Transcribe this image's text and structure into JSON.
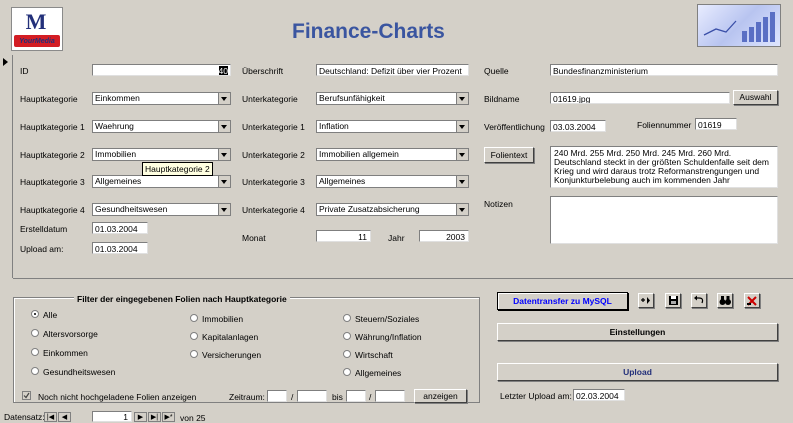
{
  "header": {
    "title": "Finance-Charts",
    "logo_text": "YourMedia",
    "logo_mark": "M"
  },
  "fields": {
    "id": {
      "label": "ID",
      "value": "40"
    },
    "hauptkategorie": {
      "label": "Hauptkategorie",
      "value": "Einkommen"
    },
    "hauptkategorie1": {
      "label": "Hauptkategorie 1",
      "value": "Waehrung"
    },
    "hauptkategorie2": {
      "label": "Hauptkategorie 2",
      "value": "Immobilien"
    },
    "hauptkategorie3": {
      "label": "Hauptkategorie 3",
      "value": "Allgemeines"
    },
    "hauptkategorie4": {
      "label": "Hauptkategorie 4",
      "value": "Gesundheitswesen"
    },
    "erstelldatum": {
      "label": "Erstelldatum",
      "value": "01.03.2004"
    },
    "upload_am": {
      "label": "Upload am:",
      "value": "01.03.2004"
    },
    "ueberschrift": {
      "label": "Überschrift",
      "value": "Deutschland: Defizit über vier Prozent"
    },
    "unterkategorie": {
      "label": "Unterkategorie",
      "value": "Berufsunfähigkeit"
    },
    "unterkategorie1": {
      "label": "Unterkategorie 1",
      "value": "Inflation"
    },
    "unterkategorie2": {
      "label": "Unterkategorie 2",
      "value": "Immobilien allgemein"
    },
    "unterkategorie3": {
      "label": "Unterkategorie 3",
      "value": "Allgemeines"
    },
    "unterkategorie4": {
      "label": "Unterkategorie 4",
      "value": "Private Zusatzabsicherung"
    },
    "monat": {
      "label": "Monat",
      "value": "11"
    },
    "jahr": {
      "label": "Jahr",
      "value": "2003"
    },
    "quelle": {
      "label": "Quelle",
      "value": "Bundesfinanzministerium"
    },
    "bildname": {
      "label": "Bildname",
      "value": "01619.jpg"
    },
    "veroeffentlichung": {
      "label": "Veröffentlichung",
      "value": "03.03.2004"
    },
    "foliennummer": {
      "label": "Foliennummer",
      "value": "01619"
    },
    "folientext": {
      "label": "Folientext",
      "value": "240 Mrd. 255 Mrd. 250 Mrd. 245 Mrd. 260 Mrd. Deutschland steckt in der größten Schuldenfalle seit dem Krieg und wird daraus trotz Reformanstrengungen und Konjunkturbelebung auch im kommenden Jahr"
    },
    "notizen": {
      "label": "Notizen",
      "value": ""
    }
  },
  "buttons": {
    "auswahl": "Auswahl",
    "datentransfer": "Datentransfer zu MySQL",
    "einstellungen": "Einstellungen",
    "upload": "Upload",
    "anzeigen": "anzeigen"
  },
  "tooltip": "Hauptkategorie 2",
  "filter": {
    "title": "Filter der eingegebenen Folien nach Hauptkategorie",
    "options": [
      "Alle",
      "Altersvorsorge",
      "Einkommen",
      "Gesundheitswesen",
      "Immobilien",
      "Kapitalanlagen",
      "Versicherungen",
      "Steuern/Soziales",
      "Währung/Inflation",
      "Wirtschaft",
      "Allgemeines"
    ],
    "selected": "Alle",
    "checkbox_label": "Noch nicht hochgeladene Folien anzeigen",
    "zeitraum": "Zeitraum:",
    "bis": "bis",
    "slash": "/"
  },
  "letzter_upload": {
    "label": "Letzter Upload am:",
    "value": "02.03.2004"
  },
  "nav": {
    "label": "Datensatz:",
    "current": "1",
    "of_label": "von 25"
  }
}
